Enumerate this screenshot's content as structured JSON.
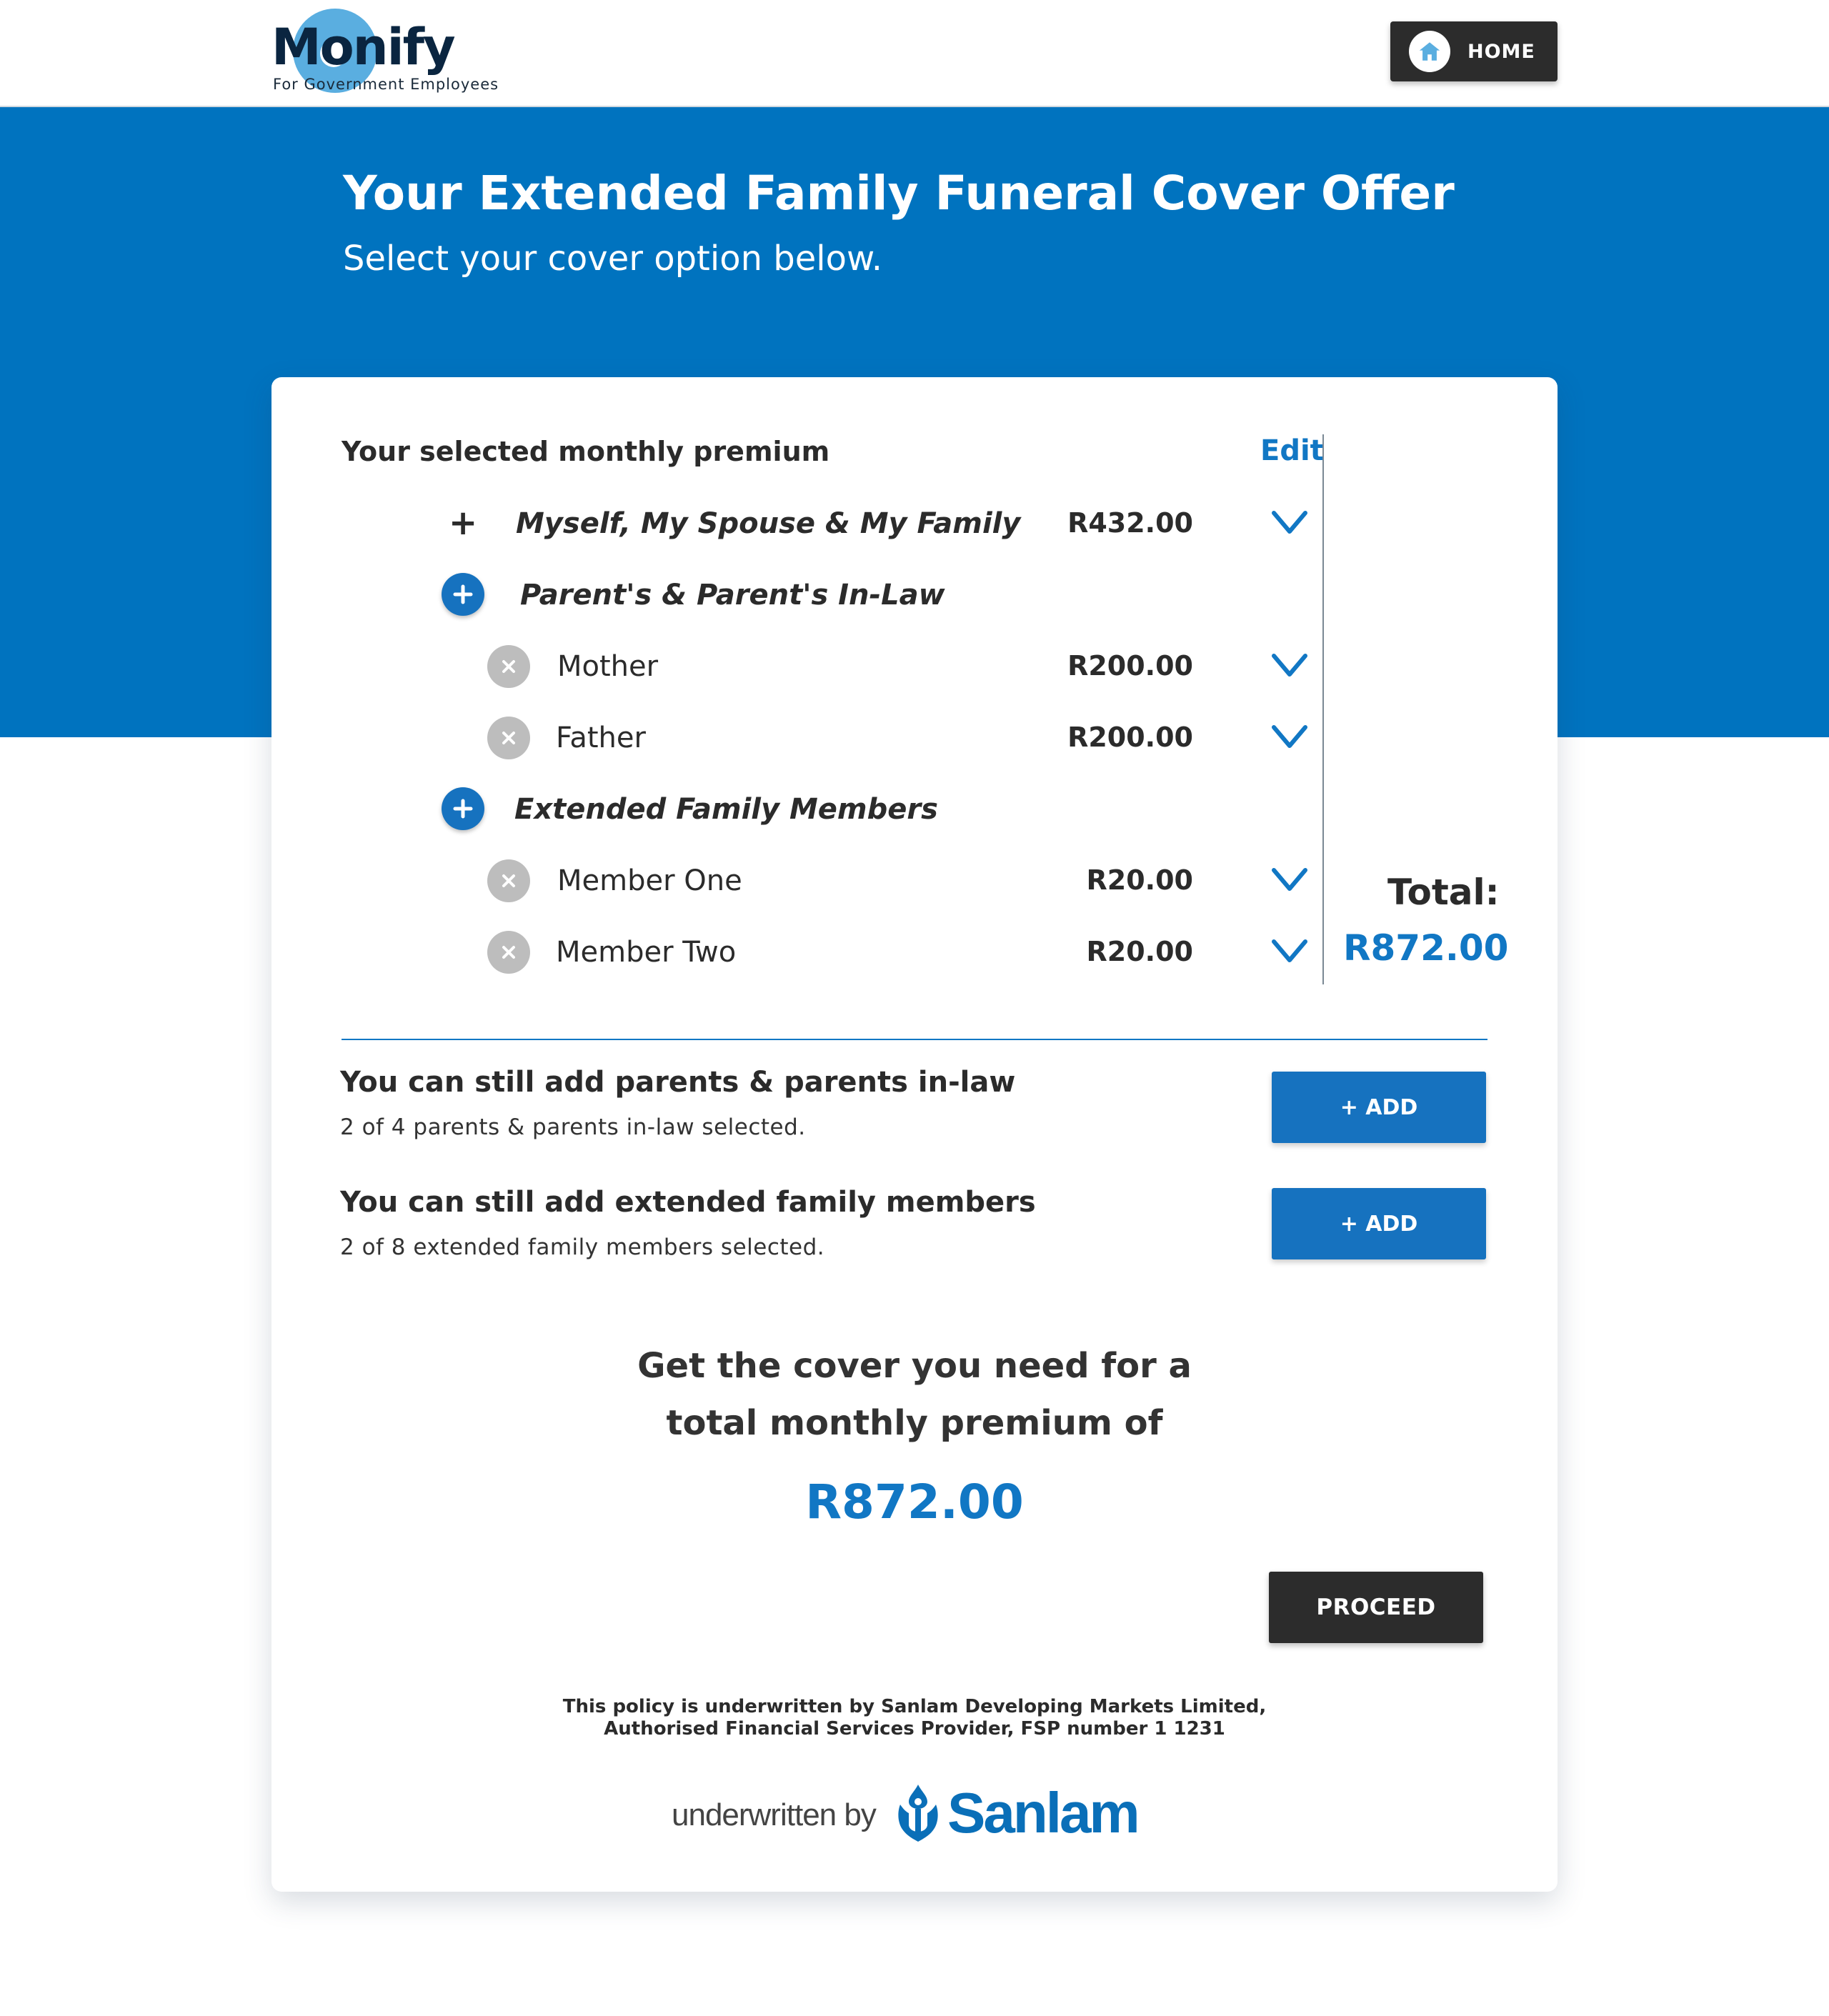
{
  "header": {
    "logo_text": "Monify",
    "logo_tagline": "For Government Employees",
    "home_label": "HOME"
  },
  "banner": {
    "title": "Your Extended Family Funeral Cover Offer",
    "subtitle": "Select your cover option below."
  },
  "premium": {
    "heading": "Your selected monthly premium",
    "edit_label": "Edit",
    "main_group": {
      "label": "Myself, My Spouse & My Family",
      "amount": "R432.00"
    },
    "parents_group": {
      "label": "Parent's & Parent's In-Law",
      "members": [
        {
          "label": "Mother",
          "amount": "R200.00"
        },
        {
          "label": "Father",
          "amount": "R200.00"
        }
      ]
    },
    "extended_group": {
      "label": "Extended Family Members",
      "members": [
        {
          "label": "Member One",
          "amount": "R20.00"
        },
        {
          "label": "Member Two",
          "amount": "R20.00"
        }
      ]
    },
    "total_label": "Total:",
    "total_amount": "R872.00"
  },
  "add_parents": {
    "title": "You can still add parents & parents in-law",
    "subtitle": "2 of 4 parents & parents in-law selected.",
    "button_label": "+ ADD"
  },
  "add_extended": {
    "title": "You can still add extended family members",
    "subtitle": "2 of 8 extended family members selected.",
    "button_label": "+ ADD"
  },
  "summary": {
    "line1": "Get the cover you need for a",
    "line2": "total monthly premium of",
    "amount": "R872.00",
    "proceed_label": "PROCEED"
  },
  "footer": {
    "policy_line1": "This policy is underwritten by Sanlam Developing Markets Limited,",
    "policy_line2": "Authorised Financial Services Provider, FSP number 1 1231",
    "underwritten_by": "underwritten by",
    "brand": "Sanlam"
  },
  "colors": {
    "primary_blue": "#0073bf",
    "accent_blue": "#1177c4",
    "dark_button": "#2c2c2c",
    "remove_grey": "#bdbdbd"
  }
}
